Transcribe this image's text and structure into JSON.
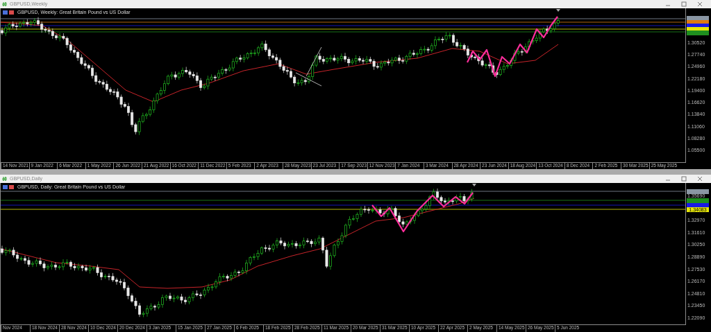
{
  "windows": [
    {
      "title": "GBPUSD,Weekly",
      "chart_label": "GBPUSD, Weekly:  Great Britain Pound vs US Dollar",
      "price_tags": [
        {
          "color": "#8a96a3"
        },
        {
          "color": "#e07b10"
        },
        {
          "color": "#1a1ae6"
        },
        {
          "color": "#e6e60a"
        },
        {
          "color": "#1f8f1f"
        }
      ],
      "price_ticks": [
        "1.30520",
        "1.27740",
        "1.24960",
        "1.22180",
        "1.19400",
        "1.16620",
        "1.13840",
        "1.11060",
        "1.08280",
        "1.05500"
      ],
      "date_labels": [
        "14 Nov 2021",
        "9 Jan 2022",
        "6 Mar 2022",
        "1 May 2022",
        "26 Jun 2022",
        "21 Aug 2022",
        "16 Oct 2022",
        "11 Dec 2022",
        "5 Feb 2023",
        "2 Apr 2023",
        "28 May 2023",
        "23 Jul 2023",
        "17 Sep 2023",
        "12 Nov 2023",
        "7 Jan 2024",
        "3 Mar 2024",
        "28 Apr 2024",
        "23 Jun 2024",
        "18 Aug 2024",
        "13 Oct 2024",
        "8 Dec 2024",
        "2 Feb 2025",
        "30 Mar 2025",
        "25 May 2025"
      ]
    },
    {
      "title": "GBPUSD,Daily",
      "chart_label": "GBPUSD, Daily:  Great Britain Pound vs US Dollar",
      "price_tags": [
        {
          "color": "#8a96a3"
        },
        {
          "color": "#1f8f1f"
        },
        {
          "color": "#1a1ae6"
        },
        {
          "color": "#e6e60a",
          "text": "1.34083"
        }
      ],
      "price_ticks": [
        "1.35690",
        "1.32970",
        "1.31610",
        "1.30250",
        "1.28890",
        "1.27530",
        "1.26170",
        "1.24810",
        "1.23450",
        "1.22090"
      ],
      "date_labels": [
        "Nov 2024",
        "18 Nov 2024",
        "28 Nov 2024",
        "10 Dec 2024",
        "20 Dec 2024",
        "3 Jan 2025",
        "15 Jan 2025",
        "27 Jan 2025",
        "6 Feb 2025",
        "18 Feb 2025",
        "28 Feb 2025",
        "11 Mar 2025",
        "20 Mar 2025",
        "31 Mar 2025",
        "10 Apr 2025",
        "22 Apr 2025",
        "2 May 2025",
        "14 May 2025",
        "26 May 2025",
        "5 Jun 2025"
      ]
    }
  ]
}
